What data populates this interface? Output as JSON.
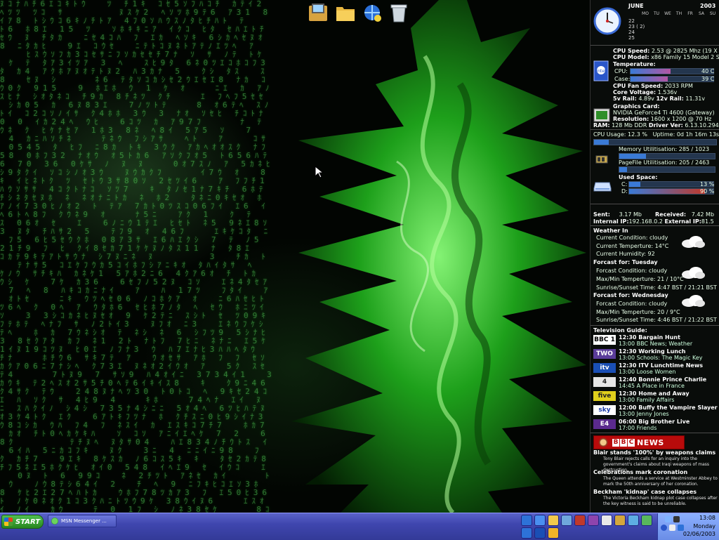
{
  "calendar": {
    "month": "JUNE",
    "year": "2003",
    "weekdays": [
      "MO",
      "TU",
      "WE",
      "TH",
      "FR",
      "SA",
      "SU"
    ],
    "week_rows": [
      "22",
      "23 ( 2)",
      "24",
      "25"
    ]
  },
  "system": {
    "cpu_speed_label": "CPU Speed:",
    "cpu_speed_value": "2.53 @ 2825 Mhz (19 X 148 MHz)",
    "cpu_model_label": "CPU Model:",
    "cpu_model_value": "x86 Family 15 Model 2 Stepping 7",
    "temperature_label": "Temperature:",
    "cpu_temp_label": "CPU:",
    "cpu_temp_value": "40 C",
    "case_temp_label": "Case:",
    "case_temp_value": "39 C",
    "fan_label": "CPU Fan Speed:",
    "fan_value": "2033 RPM",
    "voltage_label": "Core Voltage:",
    "voltage_value": "1.536v",
    "rail5_label": "5v Rail:",
    "rail5_value": "4.89v",
    "rail12_label": "12v Rail:",
    "rail12_value": "11.31v",
    "gpu_label": "Graphics Card:",
    "gpu_value": "NVIDIA GeForce4 Ti 4600 (Gateway)",
    "res_label": "Resolution:",
    "res_value": "1600 x 1200 @ 70 Hz",
    "ram_label": "RAM:",
    "ram_value": "128 Mb DDR",
    "driver_label": "Driver Ver:",
    "driver_value": "6.13.10.2942",
    "cpu_usage_text": "CPU Usage: 12.3 %",
    "uptime_text": "Uptime: 0d 1h 16m 13s",
    "cpu_usage_fraction": 0.123,
    "cpu_temp_fraction": 0.48,
    "case_temp_fraction": 0.45,
    "memory_text": "Memory Utilitisation: 285 / 1023",
    "memory_fraction": 0.28,
    "pagefile_text": "PageFile Utilitisation: 205 / 2463",
    "pagefile_fraction": 0.08,
    "used_space_label": "Used Space:",
    "drive_c_label": "C:",
    "drive_c_value": "13 %",
    "drive_c_fraction": 0.13,
    "drive_d_label": "D:",
    "drive_d_value": "90 %",
    "drive_d_fraction": 0.9
  },
  "network": {
    "sent_label": "Sent:",
    "sent_value": "3.17 Mb",
    "received_label": "Received:",
    "received_value": "7.42 Mb",
    "internal_label": "Internal IP:",
    "internal_value": "192.168.0.2",
    "external_label": "External IP:",
    "external_value": "81.5"
  },
  "weather": {
    "title": "Weather In",
    "current_condition": "Current Condition:     cloudy",
    "current_temp": "Current Temperture:    14°C",
    "current_humidity": "Current Humidity:     92",
    "forecast1_title": "Forcast for:  Tuesday",
    "forecast1_condition": "Forcast Condition:       cloudy",
    "forecast1_maxmin": "Max/Min Temperture: 21  /  10°C",
    "forecast1_sun": "Sunrise/Sunset Time:  4:47 BST  /  21:21 BST",
    "forecast2_title": "Forcast for:  Wednesday",
    "forecast2_condition": "Forcast Condition:       cloudy",
    "forecast2_maxmin": "Max/Min Temperture: 20  /  9°C",
    "forecast2_sun": "Sunrise/Sunset Time:  4:46 BST  /  21:22 BST"
  },
  "tv": {
    "title": "Television Guide:",
    "channels": [
      {
        "logo": "BBC 1",
        "now": "12:30 Bargain Hunt",
        "next": "13:00 BBC News; Weather",
        "bg": "#ffffff",
        "fg": "#000000"
      },
      {
        "logo": "TWO",
        "now": "12:30 Working Lunch",
        "next": "13:00 Schools: The Magic Key",
        "bg": "#5a3c9a",
        "fg": "#ffffff"
      },
      {
        "logo": "itv",
        "now": "12:30 ITV Lunchtime News",
        "next": "13:00 Loose Women",
        "bg": "#1a4fb5",
        "fg": "#ffffff"
      },
      {
        "logo": "4",
        "now": "12:40 Bonnie Prince Charlie",
        "next": "14:45 A Place in France",
        "bg": "#e6e6e6",
        "fg": "#222222"
      },
      {
        "logo": "five",
        "now": "12:30 Home and Away",
        "next": "13:00 Family Affairs",
        "bg": "#e0d01c",
        "fg": "#222222"
      },
      {
        "logo": "sky",
        "now": "12:00 Buffy the Vampire Slayer",
        "next": "13:00 Jenny Jones",
        "bg": "#ffffff",
        "fg": "#1a3aa8"
      },
      {
        "logo": "E4",
        "now": "06:00 Big Brother Live",
        "next": "17:00 Friends",
        "bg": "#5b2a8e",
        "fg": "#ffffff"
      }
    ]
  },
  "news": {
    "banner": "NEWS",
    "items": [
      {
        "headline": "Blair stands '100%' by weapons claims",
        "summary": "Tony Blair rejects calls for an inquiry into the government's claims about Iraqi weapons of mass destruction."
      },
      {
        "headline": "Celebrations mark coronation",
        "summary": "The Queen attends a service at Westminster Abbey to mark the 50th anniversary of her coronation."
      },
      {
        "headline": "Beckham 'kidnap' case collapses",
        "summary": "The Victoria Beckham kidnap plot case collapses after the key witness is said to be unreliable."
      }
    ]
  },
  "taskbar": {
    "start_label": "START",
    "msn_label": "MSN Messenger ...",
    "time": "13:08",
    "day": "Monday",
    "date": "02/06/2003"
  },
  "icons": {
    "dock": [
      "pc-folder-icon",
      "folder-icon",
      "network-icon",
      "recycle-bin-icon"
    ]
  }
}
